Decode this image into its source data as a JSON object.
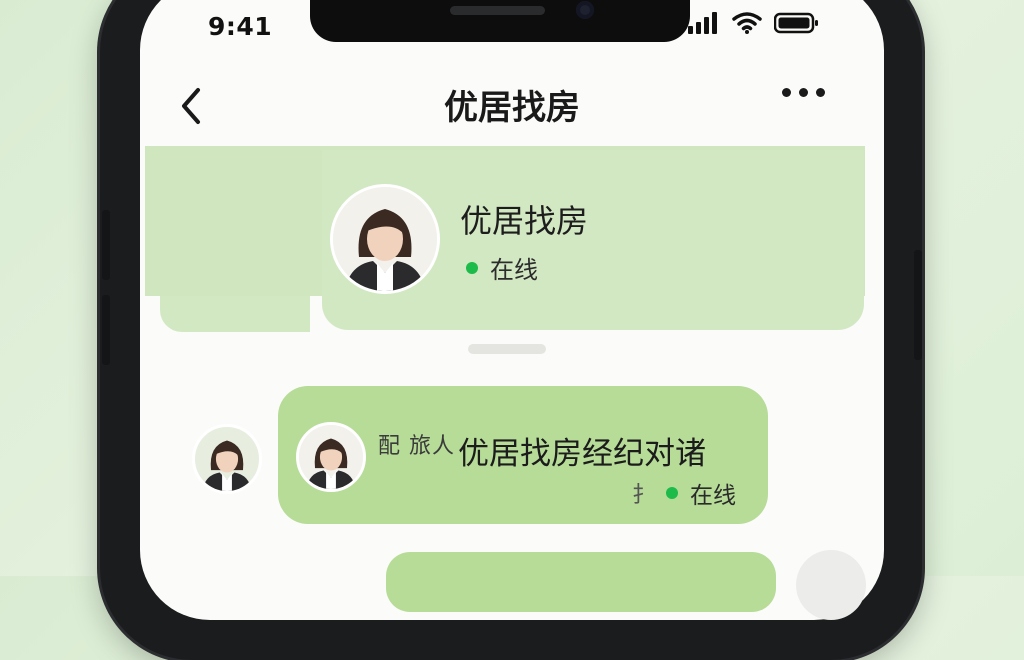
{
  "status_bar": {
    "time": "9:41"
  },
  "nav": {
    "title": "优居找房"
  },
  "profile": {
    "name": "优居找房",
    "status": "在线"
  },
  "message": {
    "garbled_prefix": "配 旅人",
    "text": "优居找房经纪对诸",
    "status_glyph": "扌",
    "status": "在线"
  },
  "colors": {
    "background": "#dcefd6",
    "profile_band": "#cfe6bf",
    "bubble": "#b6dc98",
    "online_dot": "#1dbb4a"
  },
  "icons": [
    "back-chevron-icon",
    "more-icon",
    "signal-icon",
    "wifi-icon",
    "battery-icon"
  ]
}
